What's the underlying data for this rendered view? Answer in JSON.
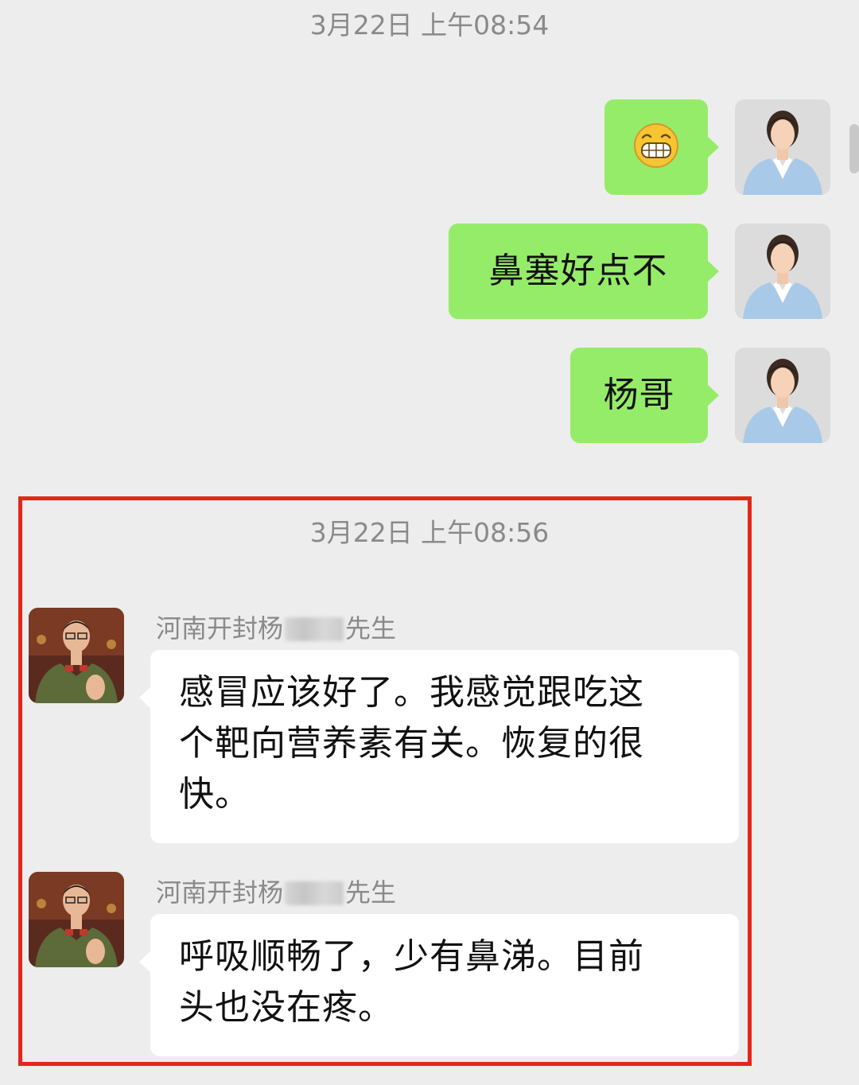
{
  "timestamps": [
    "3月22日 上午08:54",
    "3月22日 上午08:56"
  ],
  "outgoing": [
    {
      "kind": "emoji",
      "emoji": "grinning-face-emoji"
    },
    {
      "kind": "text",
      "text": "鼻塞好点不"
    },
    {
      "kind": "text",
      "text": "杨哥"
    }
  ],
  "incoming": [
    {
      "sender_prefix": "河南开封杨",
      "sender_suffix": "先生",
      "lines": [
        "感冒应该好了。我感觉跟吃这",
        "个靶向营养素有关。恢复的很",
        "快。"
      ]
    },
    {
      "sender_prefix": "河南开封杨",
      "sender_suffix": "先生",
      "lines": [
        "呼吸顺畅了，少有鼻涕。目前",
        "头也没在疼。"
      ]
    }
  ],
  "colors": {
    "background": "#ededed",
    "outgoing_bubble": "#95ec69",
    "incoming_bubble": "#ffffff",
    "highlight_frame": "#e4261b",
    "timestamp_text": "#8a8a8a"
  }
}
